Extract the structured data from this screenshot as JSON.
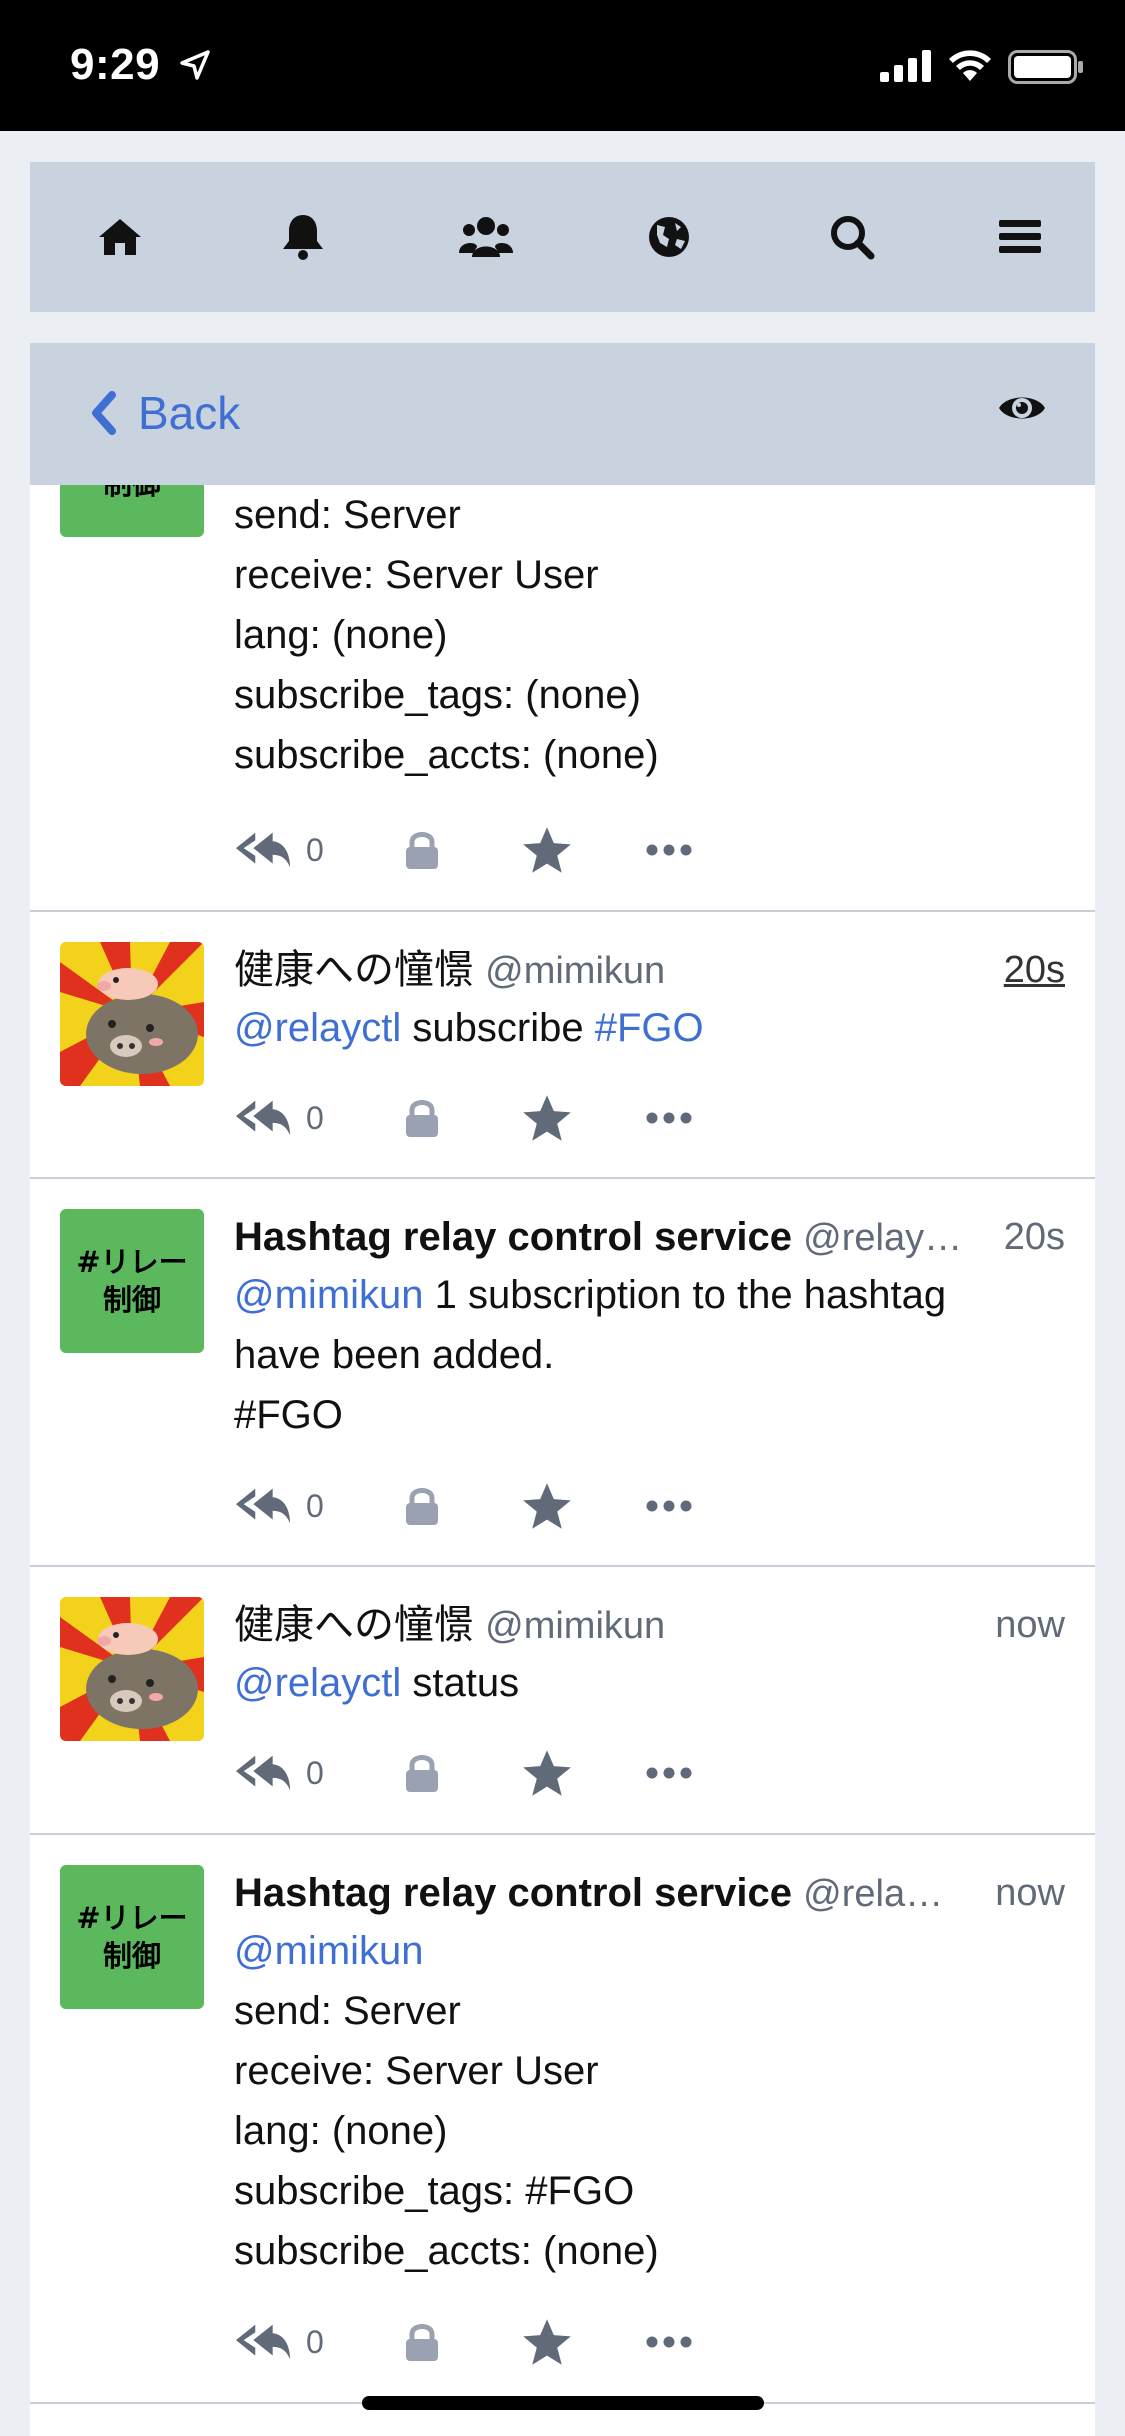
{
  "status_bar": {
    "time": "9:29"
  },
  "nav": {
    "items": [
      {
        "icon": "home-icon"
      },
      {
        "icon": "bell-icon"
      },
      {
        "icon": "users-icon"
      },
      {
        "icon": "globe-icon"
      },
      {
        "icon": "search-icon"
      },
      {
        "icon": "menu-icon"
      }
    ]
  },
  "back_bar": {
    "back_label": "Back",
    "eye_icon": "eye-icon"
  },
  "colors": {
    "accent": "#3f6fd3",
    "bar_bg": "#c9d3e0",
    "avatar_green": "#5cb85c",
    "icon_gray": "#606a78"
  },
  "posts": [
    {
      "lines": [
        "send: Server",
        "receive: Server User",
        "lang: (none)",
        "subscribe_tags: (none)",
        "subscribe_accts: (none)"
      ],
      "replies": "0"
    },
    {
      "display_name": "健康への憧憬",
      "acct": "@mimikun",
      "time": "20s",
      "mention": "@relayctl",
      "text": " subscribe ",
      "hashtag": "#FGO",
      "replies": "0"
    },
    {
      "display_name": "Hashtag relay control service",
      "acct": "@relay…",
      "time": "20s",
      "avatar_line1": "#リレー",
      "avatar_line2": "制御",
      "mention": "@mimikun",
      "text_line1": " 1 subscription to the hashtag",
      "text_line2": "have been added.",
      "text_line3": "#FGO",
      "replies": "0"
    },
    {
      "display_name": "健康への憧憬",
      "acct": "@mimikun",
      "time": "now",
      "mention": "@relayctl",
      "text": " status",
      "replies": "0"
    },
    {
      "display_name": "Hashtag relay control service",
      "acct": "@rela…",
      "time": "now",
      "avatar_line1": "#リレー",
      "avatar_line2": "制御",
      "mention": "@mimikun",
      "lines": [
        "send: Server",
        "receive: Server User",
        "lang: (none)",
        "subscribe_tags: #FGO",
        "subscribe_accts: (none)"
      ],
      "replies": "0"
    }
  ]
}
